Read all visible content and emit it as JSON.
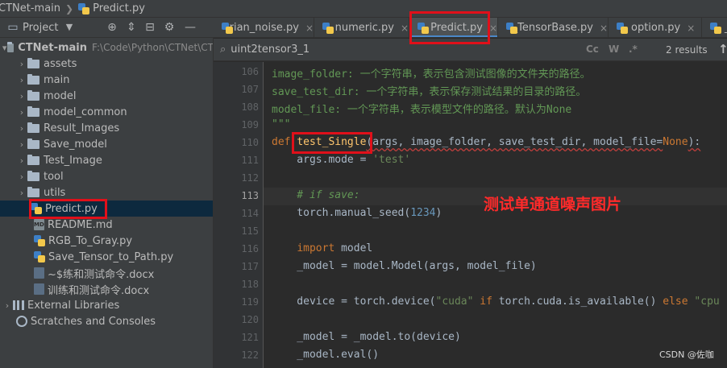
{
  "breadcrumb": {
    "project": "CTNet-main",
    "file": "Predict.py"
  },
  "project_panel": {
    "title": "Project",
    "tree": [
      {
        "label": "CTNet-main",
        "path": "F:\\Code\\Python\\CTNet\\CT",
        "type": "project",
        "expanded": true,
        "depth": 0
      },
      {
        "label": "assets",
        "type": "folder",
        "depth": 1
      },
      {
        "label": "main",
        "type": "folder",
        "depth": 1
      },
      {
        "label": "model",
        "type": "folder",
        "depth": 1
      },
      {
        "label": "model_common",
        "type": "folder",
        "depth": 1
      },
      {
        "label": "Result_Images",
        "type": "folder",
        "depth": 1
      },
      {
        "label": "Save_model",
        "type": "folder",
        "depth": 1
      },
      {
        "label": "Test_Image",
        "type": "folder",
        "depth": 1
      },
      {
        "label": "tool",
        "type": "folder",
        "depth": 1
      },
      {
        "label": "utils",
        "type": "folder",
        "depth": 1
      },
      {
        "label": "Predict.py",
        "type": "python",
        "depth": 1,
        "selected": true
      },
      {
        "label": "README.md",
        "type": "markdown",
        "depth": 1
      },
      {
        "label": "RGB_To_Gray.py",
        "type": "python",
        "depth": 1
      },
      {
        "label": "Save_Tensor_to_Path.py",
        "type": "python",
        "depth": 1
      },
      {
        "label": "~$练和测试命令.docx",
        "type": "docx",
        "depth": 1
      },
      {
        "label": "训练和测试命令.docx",
        "type": "docx",
        "depth": 1
      },
      {
        "label": "External Libraries",
        "type": "library",
        "depth": 0
      },
      {
        "label": "Scratches and Consoles",
        "type": "scratch",
        "depth": 0
      }
    ]
  },
  "tabs": [
    {
      "label": "trian_noise.py"
    },
    {
      "label": "numeric.py"
    },
    {
      "label": "Predict.py",
      "active": true
    },
    {
      "label": "_TensorBase.py"
    },
    {
      "label": "option.py"
    },
    {
      "label": "_i"
    }
  ],
  "search": {
    "query": "uint2tensor3_1",
    "options": [
      "Cc",
      "W",
      ".*"
    ],
    "results": "2 results"
  },
  "editor": {
    "current_line": "113",
    "lines": [
      {
        "num": "106",
        "tokens": [
          {
            "t": "image_folder: 一个字符串，表示包含测试图像的文件夹的路径。",
            "c": "doc"
          }
        ]
      },
      {
        "num": "107",
        "tokens": [
          {
            "t": "save_test_dir: 一个字符串，表示保存测试结果的目录的路径。",
            "c": "doc"
          }
        ]
      },
      {
        "num": "108",
        "tokens": [
          {
            "t": "model_file: 一个字符串，表示模型文件的路径。默认为None",
            "c": "doc"
          }
        ]
      },
      {
        "num": "109",
        "tokens": [
          {
            "t": "\"\"\"",
            "c": "doc"
          }
        ]
      },
      {
        "num": "110",
        "tokens": [
          {
            "t": "def ",
            "c": "kw"
          },
          {
            "t": "test_Single",
            "c": "fn"
          },
          {
            "t": "(args, image_folder, save_test_dir, model_file=",
            "c": "plain"
          },
          {
            "t": "None",
            "c": "kw"
          },
          {
            "t": "):",
            "c": "plain"
          }
        ]
      },
      {
        "num": "111",
        "tokens": [
          {
            "t": "    args.mode = ",
            "c": "plain"
          },
          {
            "t": "'test'",
            "c": "str"
          }
        ]
      },
      {
        "num": "112",
        "tokens": []
      },
      {
        "num": "113",
        "tokens": [
          {
            "t": "    # if save:",
            "c": "comm"
          }
        ]
      },
      {
        "num": "114",
        "tokens": [
          {
            "t": "    torch.manual_seed(",
            "c": "plain"
          },
          {
            "t": "1234",
            "c": "num"
          },
          {
            "t": ")",
            "c": "plain"
          }
        ]
      },
      {
        "num": "115",
        "tokens": []
      },
      {
        "num": "116",
        "tokens": [
          {
            "t": "    ",
            "c": "plain"
          },
          {
            "t": "import ",
            "c": "kw"
          },
          {
            "t": "model",
            "c": "plain"
          }
        ]
      },
      {
        "num": "117",
        "tokens": [
          {
            "t": "    _model = model.Model(args, model_file)",
            "c": "plain"
          }
        ]
      },
      {
        "num": "118",
        "tokens": []
      },
      {
        "num": "119",
        "tokens": [
          {
            "t": "    device = torch.device(",
            "c": "plain"
          },
          {
            "t": "\"cuda\"",
            "c": "str"
          },
          {
            "t": " if ",
            "c": "kw"
          },
          {
            "t": "torch.cuda.is_available() ",
            "c": "plain"
          },
          {
            "t": "else ",
            "c": "kw"
          },
          {
            "t": "\"cpu",
            "c": "str"
          }
        ]
      },
      {
        "num": "120",
        "tokens": []
      },
      {
        "num": "121",
        "tokens": [
          {
            "t": "    _model = _model.to(device)",
            "c": "plain"
          }
        ]
      },
      {
        "num": "122",
        "tokens": [
          {
            "t": "    _model.eval()",
            "c": "plain"
          }
        ]
      }
    ]
  },
  "annotation": "测试单通道噪声图片",
  "watermark": "CSDN @佐咖",
  "colors": {
    "highlight_box": "#e0101a",
    "annotation_text": "#ff2a2a",
    "tab_active_underline": "#4a88c7"
  }
}
